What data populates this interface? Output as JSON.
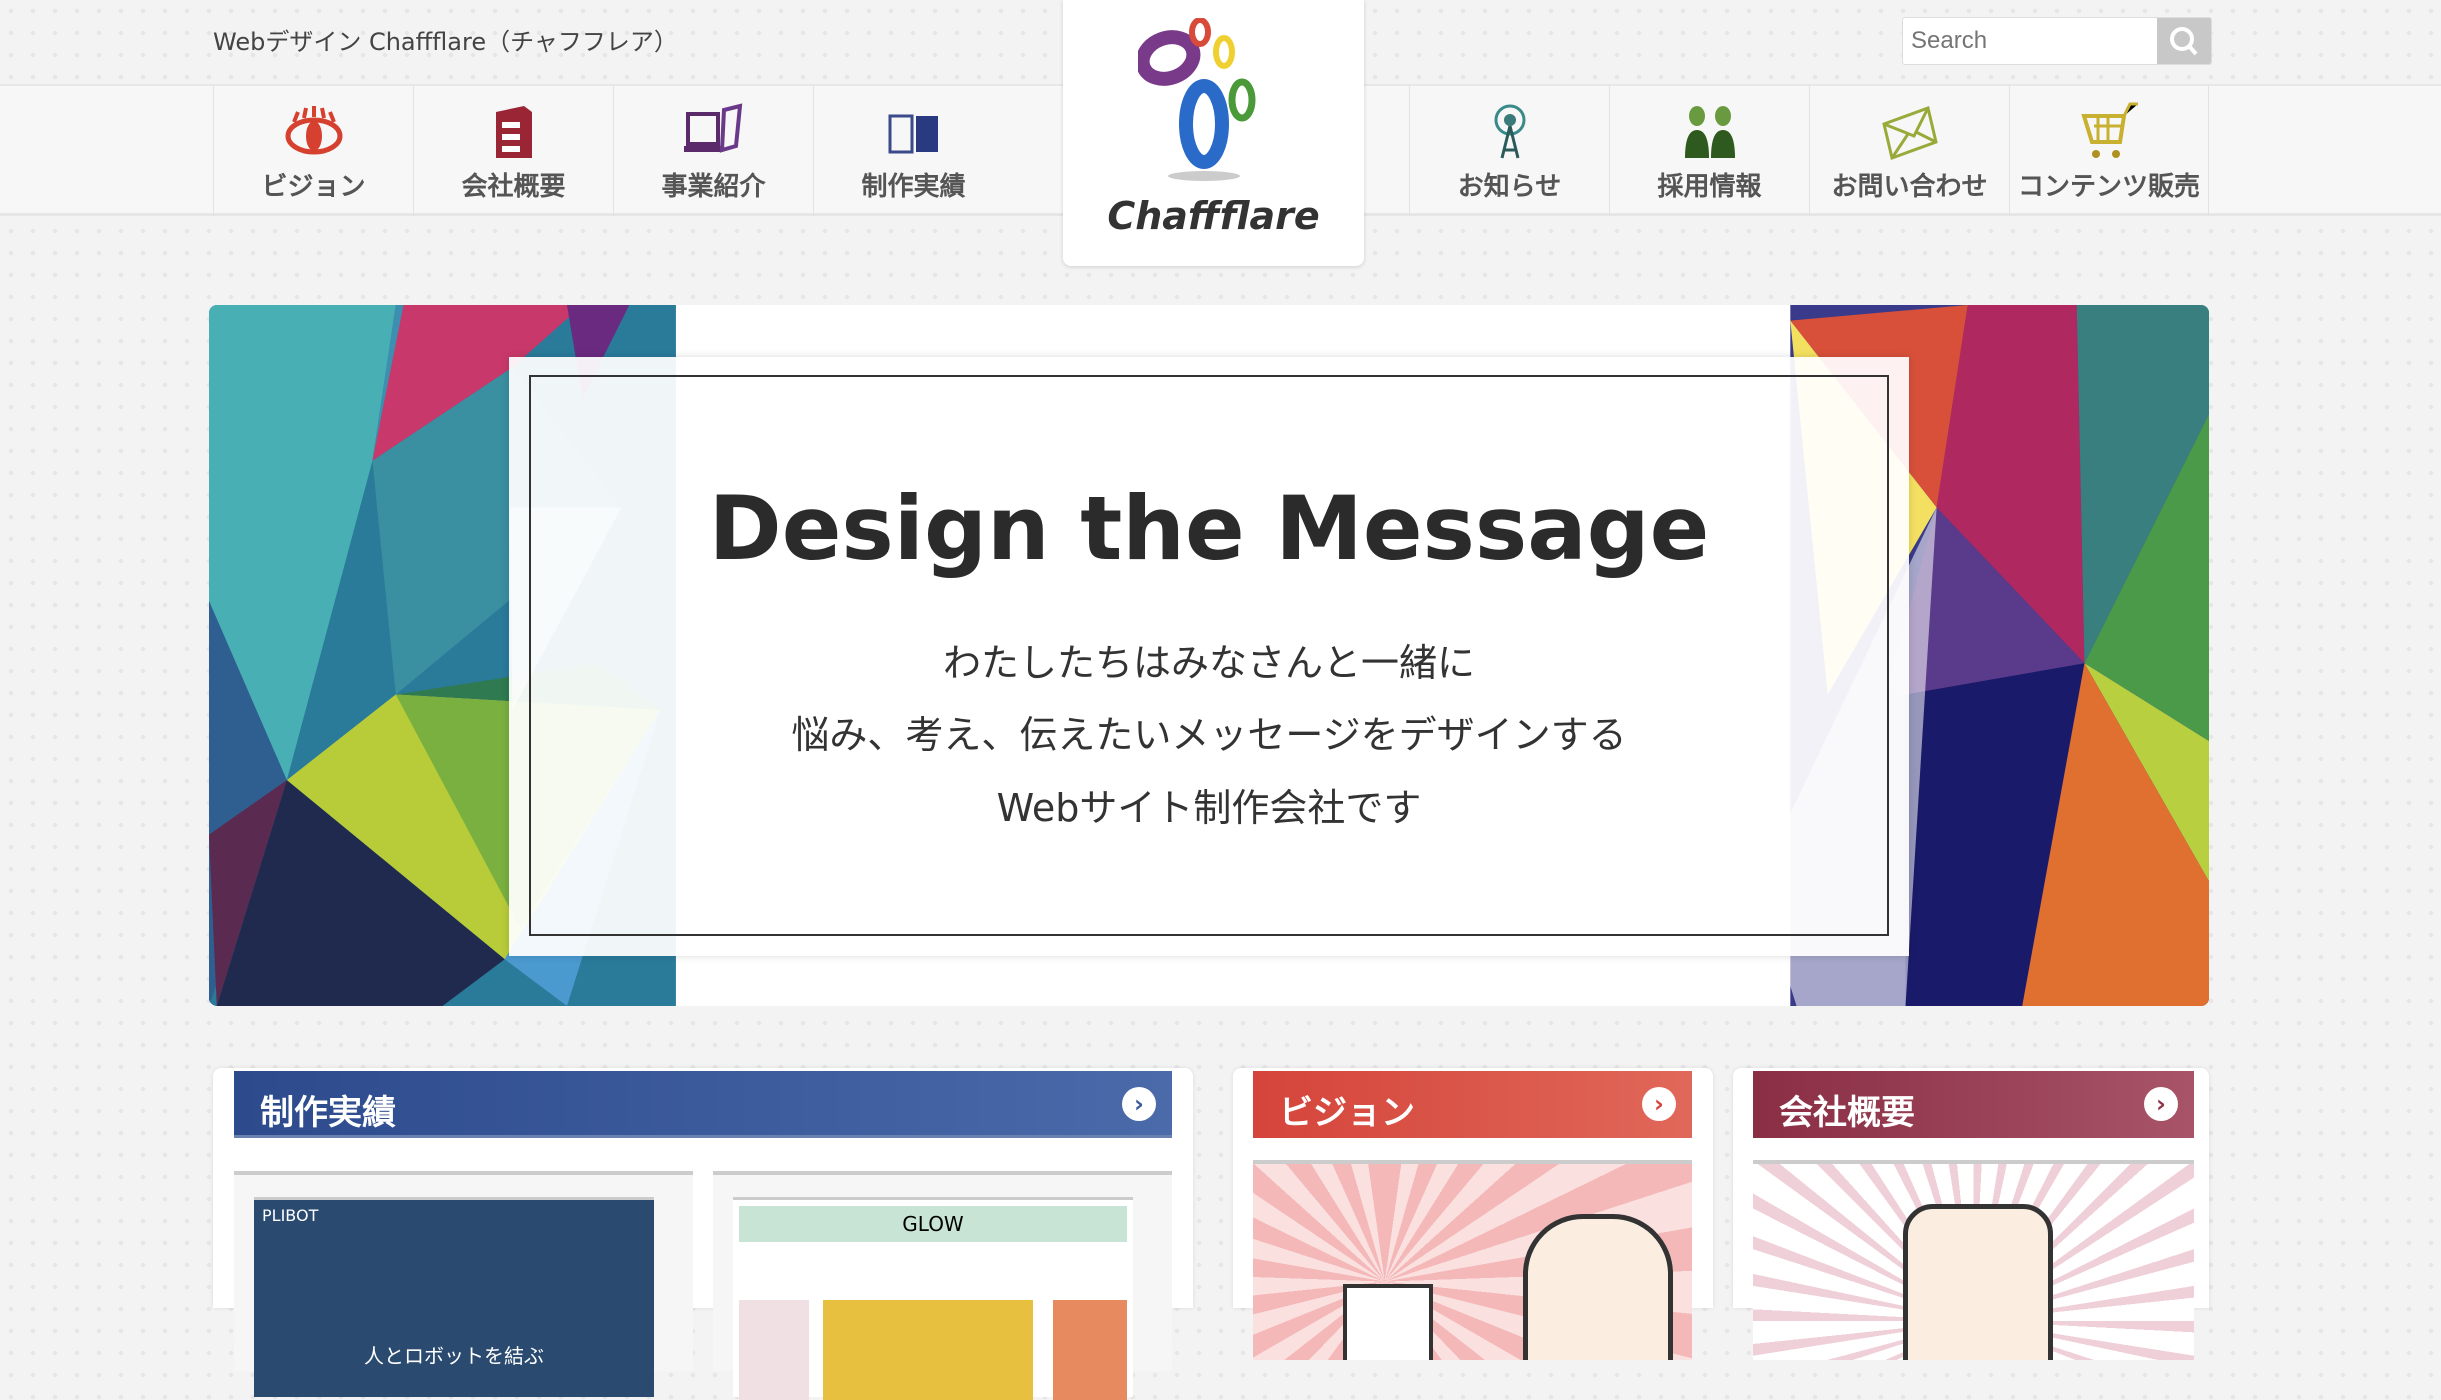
{
  "header": {
    "site_title": "Webデザイン Chaffflare（チャフフレア）",
    "search_placeholder": "Search"
  },
  "logo": {
    "text": "Chaffflare"
  },
  "nav": {
    "left": [
      {
        "label": "ビジョン",
        "icon": "eye-icon"
      },
      {
        "label": "会社概要",
        "icon": "building-icon"
      },
      {
        "label": "事業紹介",
        "icon": "devices-icon"
      },
      {
        "label": "制作実績",
        "icon": "book-icon"
      }
    ],
    "right": [
      {
        "label": "お知らせ",
        "icon": "antenna-icon"
      },
      {
        "label": "採用情報",
        "icon": "people-icon"
      },
      {
        "label": "お問い合わせ",
        "icon": "envelope-icon"
      },
      {
        "label": "コンテンツ販売",
        "icon": "cart-icon"
      }
    ]
  },
  "banner": {
    "heading": "Design the Message",
    "lines": [
      "わたしたちはみなさんと一緒に",
      "悩み、考え、伝えたいメッセージをデザインする",
      "Webサイト制作会社です"
    ]
  },
  "cards": [
    {
      "title": "制作実績",
      "color": "#2f4f91",
      "thumbs": [
        {
          "brand": "PLIBOT",
          "caption": "人とロボットを結ぶ"
        },
        {
          "brand": "GLOW",
          "caption": ""
        }
      ]
    },
    {
      "title": "ビジョン",
      "color": "#d9483c"
    },
    {
      "title": "会社概要",
      "color": "#8e3348"
    }
  ]
}
